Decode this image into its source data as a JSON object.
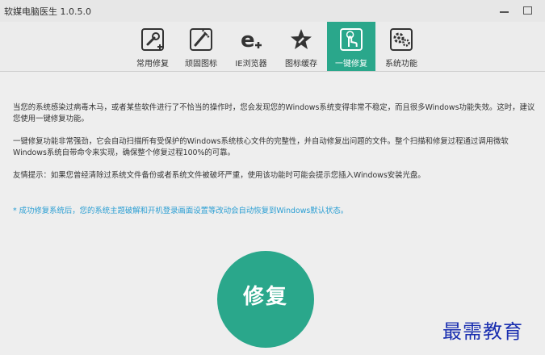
{
  "window": {
    "title": "软媒电脑医生 1.0.5.0"
  },
  "toolbar": {
    "tabs": [
      {
        "label": "常用修复",
        "icon": "wrench-fix-icon",
        "active": false
      },
      {
        "label": "顽固图标",
        "icon": "stubborn-icon-repair-icon",
        "active": false
      },
      {
        "label": "IE浏览器",
        "icon": "ie-browser-icon",
        "active": false
      },
      {
        "label": "图标缓存",
        "icon": "icon-cache-icon",
        "active": false
      },
      {
        "label": "一键修复",
        "icon": "one-click-repair-icon",
        "active": true
      },
      {
        "label": "系统功能",
        "icon": "system-function-icon",
        "active": false
      }
    ]
  },
  "content": {
    "paragraph1": "当您的系统感染过病毒木马，或者某些软件进行了不恰当的操作时，您会发现您的Windows系统变得非常不稳定，而且很多Windows功能失效。这时，建议您使用一键修复功能。",
    "paragraph2": "一键修复功能非常强劲，它会自动扫描所有受保护的Windows系统核心文件的完整性，并自动修复出问题的文件。整个扫描和修复过程通过调用微软Windows系统自带命令来实现，确保整个修复过程100%的可靠。",
    "paragraph3": "友情提示：如果您曾经清除过系统文件备份或者系统文件被破坏严重，使用该功能时可能会提示您插入Windows安装光盘。",
    "note": "* 成功修复系统后，您的系统主题破解和开机登录画面设置等改动会自动恢复到Windows默认状态。",
    "repair_button": "修复"
  },
  "watermark": "最需教育",
  "colors": {
    "accent": "#2aa78b",
    "note": "#2a9ed3",
    "watermark": "#1a2fb0"
  }
}
